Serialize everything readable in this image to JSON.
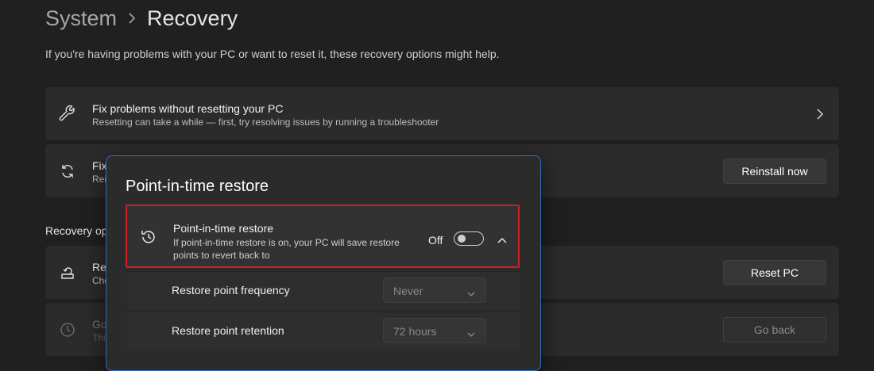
{
  "breadcrumb": {
    "parent": "System",
    "current": "Recovery"
  },
  "description": "If you're having problems with your PC or want to reset it, these recovery options might help.",
  "cards": {
    "fix": {
      "title": "Fix problems without resetting your PC",
      "subtitle": "Resetting can take a while — first, try resolving issues by running a troubleshooter",
      "icon": "wrench-icon"
    },
    "fix_update": {
      "title_visible": "Fix",
      "subtitle_visible": "Rei",
      "button": "Reinstall now",
      "icon": "sync-icon"
    },
    "reset": {
      "title_visible": "Re",
      "subtitle_visible": "Cho",
      "button": "Reset PC",
      "icon": "reset-pc-icon"
    },
    "go_back": {
      "title_visible": "Go",
      "subtitle_visible": "This",
      "button": "Go back",
      "icon": "history-icon",
      "disabled": true
    }
  },
  "section_label": "Recovery op",
  "dialog": {
    "title": "Point-in-time restore",
    "restore_row": {
      "title": "Point-in-time restore",
      "subtitle": "If point-in-time restore is on, your PC will save restore points to revert back to",
      "state": "Off",
      "toggle_on": false,
      "icon": "restore-history-icon"
    },
    "frequency": {
      "label": "Restore point frequency",
      "value": "Never"
    },
    "retention": {
      "label": "Restore point retention",
      "value": "72 hours"
    }
  },
  "colors": {
    "background": "#202020",
    "card": "#2b2b2b",
    "dialog_border": "#2f6fb7",
    "highlight": "#d01f25"
  }
}
